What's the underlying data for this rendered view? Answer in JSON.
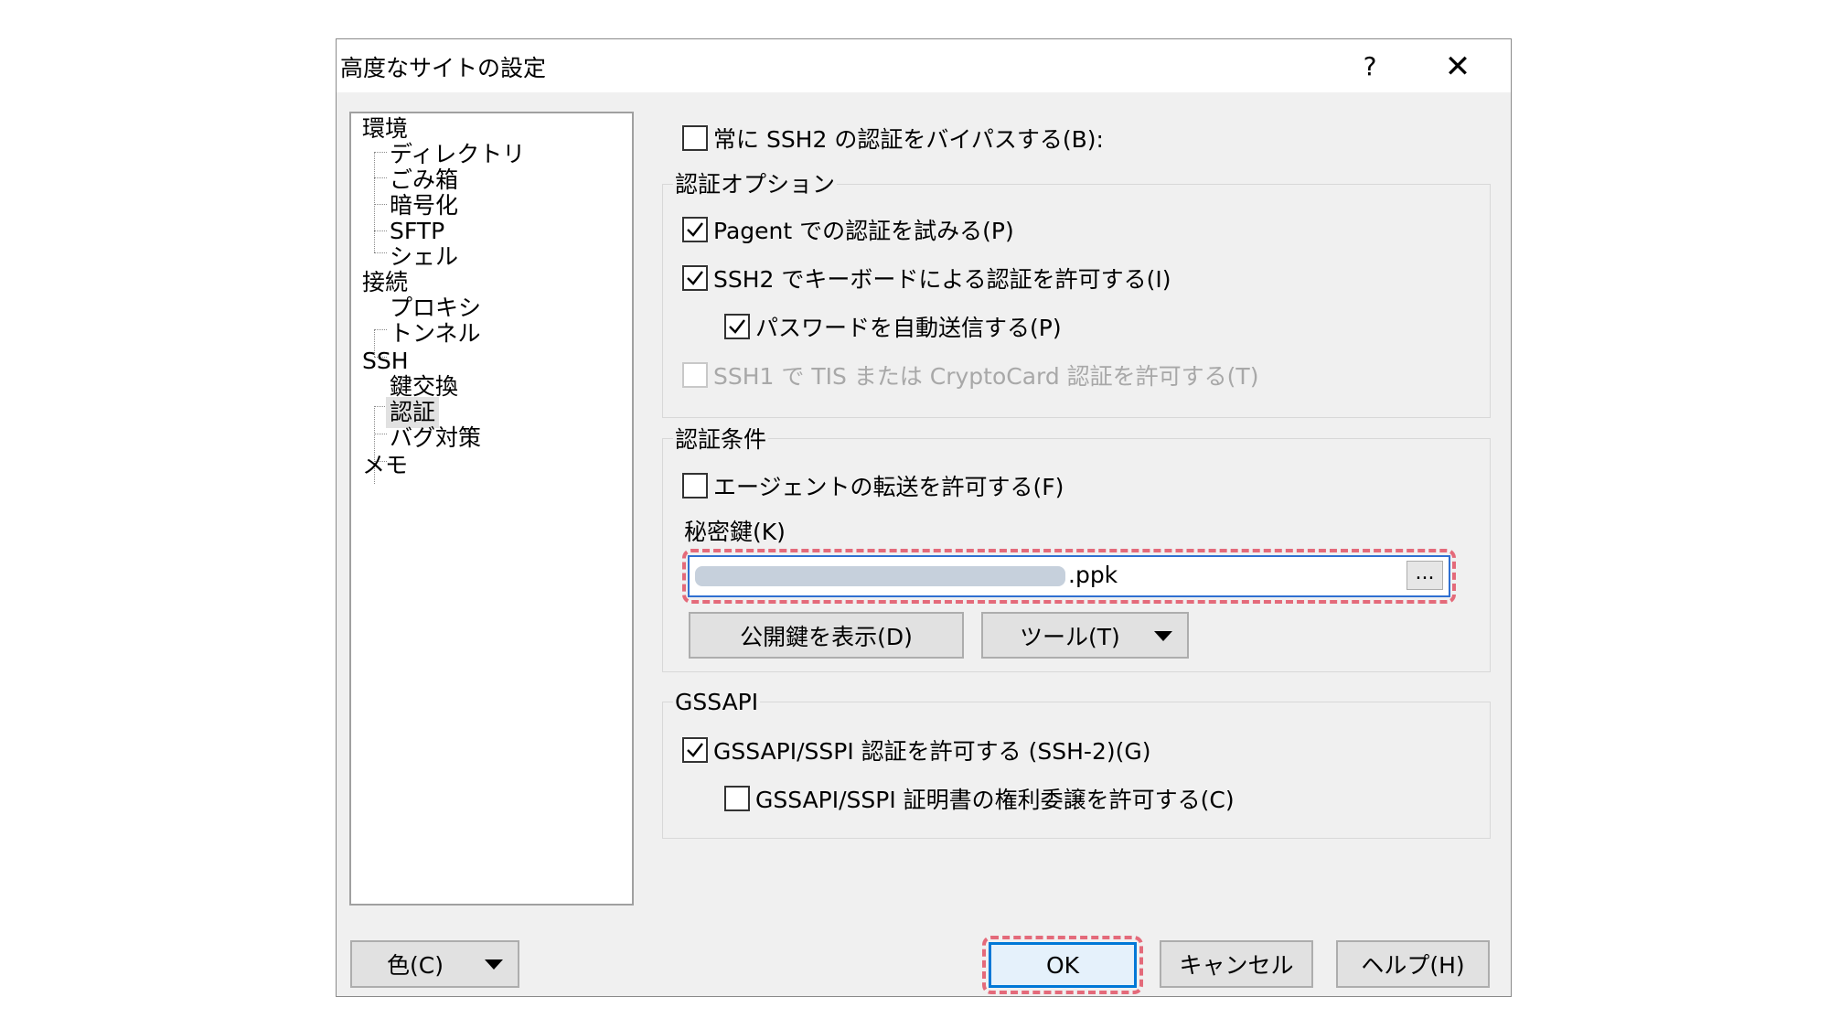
{
  "dialog": {
    "title": "高度なサイトの設定",
    "help_label": "?",
    "close_label": "✕"
  },
  "tree": {
    "items": [
      {
        "label": "環境"
      },
      {
        "label": "ディレクトリ"
      },
      {
        "label": "ごみ箱"
      },
      {
        "label": "暗号化"
      },
      {
        "label": "SFTP"
      },
      {
        "label": "シェル"
      },
      {
        "label": "接続"
      },
      {
        "label": "プロキシ"
      },
      {
        "label": "トンネル"
      },
      {
        "label": "SSH"
      },
      {
        "label": "鍵交換"
      },
      {
        "label": "認証",
        "selected": true
      },
      {
        "label": "バグ対策"
      },
      {
        "label": "メモ"
      }
    ]
  },
  "bypass": {
    "label": "常に SSH2 の認証をバイパスする(B):",
    "checked": false
  },
  "auth_options": {
    "title": "認証オプション",
    "pageant": {
      "label": "Pagent での認証を試みる(P)",
      "checked": true
    },
    "keyboard": {
      "label": "SSH2 でキーボードによる認証を許可する(I)",
      "checked": true
    },
    "auto_password": {
      "label": "パスワードを自動送信する(P)",
      "checked": true
    },
    "tis": {
      "label": "SSH1 で TIS または CryptoCard 認証を許可する(T)",
      "checked": false,
      "disabled": true
    }
  },
  "auth_params": {
    "title": "認証条件",
    "agent_forward": {
      "label": "エージェントの転送を許可する(F)",
      "checked": false
    },
    "private_key_label": "秘密鍵(K)",
    "private_key_value": ".ppk",
    "browse_label": "...",
    "show_public_key": "公開鍵を表示(D)",
    "tools": "ツール(T)"
  },
  "gssapi": {
    "title": "GSSAPI",
    "allow": {
      "label": "GSSAPI/SSPI 認証を許可する (SSH-2)(G)",
      "checked": true
    },
    "delegation": {
      "label": "GSSAPI/SSPI 証明書の権利委譲を許可する(C)",
      "checked": false
    }
  },
  "footer": {
    "color": "色(C)",
    "ok": "OK",
    "cancel": "キャンセル",
    "help": "ヘルプ(H)"
  },
  "colors": {
    "highlight": "#e46a7a",
    "focus": "#0078d7"
  }
}
